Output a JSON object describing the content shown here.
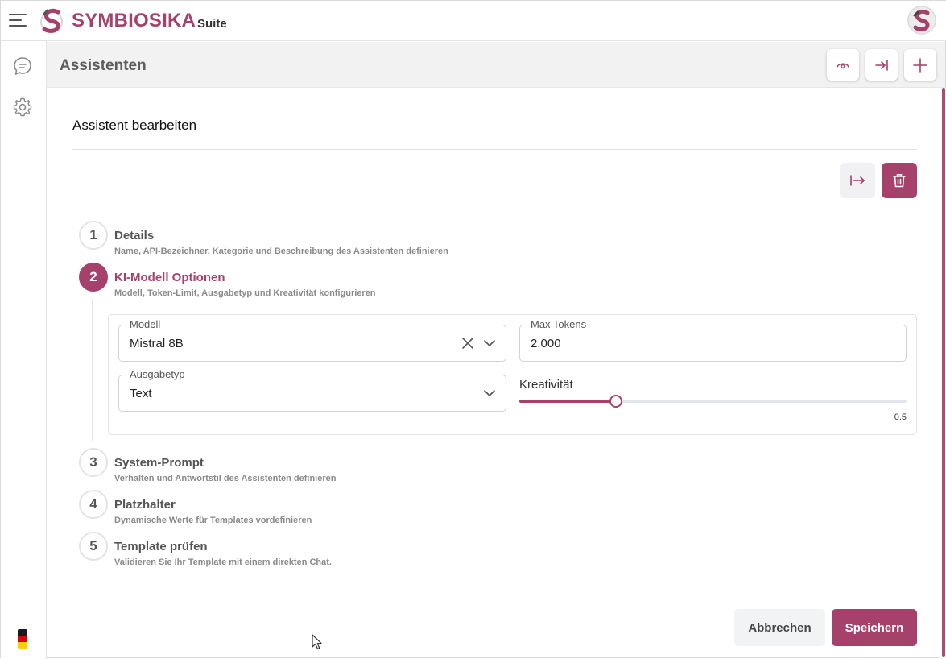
{
  "app": {
    "brand_name": "SYMBIOSIKA",
    "brand_suffix": "Suite",
    "accent_color": "#a5416b"
  },
  "sidebar": {
    "items": [
      {
        "icon": "chat-icon"
      },
      {
        "icon": "gear-icon"
      }
    ],
    "language_flag": "de"
  },
  "page": {
    "title": "Assistenten",
    "header_actions": [
      {
        "icon": "eye-icon"
      },
      {
        "icon": "arrow-right-bar-icon"
      },
      {
        "icon": "plus-icon"
      }
    ]
  },
  "editor": {
    "title": "Assistent bearbeiten",
    "actions": [
      {
        "icon": "arrow-right-from-bar-icon"
      },
      {
        "icon": "trash-icon"
      }
    ],
    "steps": [
      {
        "number": "1",
        "label": "Details",
        "description": "Name, API-Bezeichner, Kategorie und Beschreibung des Assistenten definieren",
        "active": false
      },
      {
        "number": "2",
        "label": "KI-Modell Optionen",
        "description": "Modell, Token-Limit, Ausgabetyp und Kreativität konfigurieren",
        "active": true
      },
      {
        "number": "3",
        "label": "System-Prompt",
        "description": "Verhalten und Antwortstil des Assistenten definieren",
        "active": false
      },
      {
        "number": "4",
        "label": "Platzhalter",
        "description": "Dynamische Werte für Templates vordefinieren",
        "active": false
      },
      {
        "number": "5",
        "label": "Template prüfen",
        "description": "Validieren Sie Ihr Template mit einem direkten Chat.",
        "active": false
      }
    ],
    "model_options": {
      "model_label": "Modell",
      "model_value": "Mistral 8B",
      "max_tokens_label": "Max Tokens",
      "max_tokens_value": "2.000",
      "output_type_label": "Ausgabetyp",
      "output_type_value": "Text",
      "creativity_label": "Kreativität",
      "creativity_value": 0.5,
      "creativity_display": "0.5"
    },
    "buttons": {
      "cancel_label": "Abbrechen",
      "save_label": "Speichern"
    }
  }
}
